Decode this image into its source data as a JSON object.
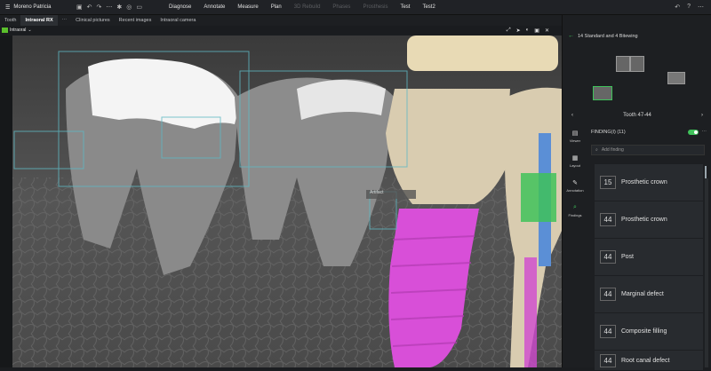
{
  "topbar": {
    "patient_name": "Moreno Patricia",
    "menu": [
      {
        "label": "Diagnose",
        "enabled": true
      },
      {
        "label": "Annotate",
        "enabled": true
      },
      {
        "label": "Measure",
        "enabled": true
      },
      {
        "label": "Plan",
        "enabled": true
      },
      {
        "label": "3D Rebuild",
        "enabled": false
      },
      {
        "label": "Phases",
        "enabled": false
      },
      {
        "label": "Prosthesis",
        "enabled": false
      },
      {
        "label": "Test",
        "enabled": true
      },
      {
        "label": "Test2",
        "enabled": true
      }
    ]
  },
  "tabs": [
    "Tooth",
    "Intraoral RX",
    "Clinical pictures",
    "Recent images",
    "Intraoral camera"
  ],
  "active_tab": "Intraoral RX",
  "image_type": "Intraoral",
  "image_annotation": "Artifact",
  "panel": {
    "series_title": "14 Standard and 4 Bitewing",
    "tooth_nav": "Tooth  47-44",
    "sidebar": [
      {
        "label": "Viewer",
        "icon": "viewer-icon"
      },
      {
        "label": "Layout",
        "icon": "layout-icon"
      },
      {
        "label": "Annotation",
        "icon": "pencil-icon"
      },
      {
        "label": "Findings",
        "icon": "findings-icon"
      }
    ],
    "findings_header": "FINDING(I) (11)",
    "add_finding_placeholder": "Add finding",
    "findings": [
      {
        "tooth": "15",
        "label": "Prosthetic crown",
        "color": "#9aa6ad"
      },
      {
        "tooth": "44",
        "label": "Prosthetic crown",
        "color": "#9aa6ad"
      },
      {
        "tooth": "44",
        "label": "Post",
        "color": "#5b8fd6"
      },
      {
        "tooth": "44",
        "label": "Marginal defect",
        "color": "#e0a13a"
      },
      {
        "tooth": "44",
        "label": "Composite filling",
        "color": "#3fc25a"
      },
      {
        "tooth": "44",
        "label": "Root canal defect",
        "color": "#d04ad0"
      }
    ]
  },
  "colors": {
    "accent": "#3fc25a",
    "implant": "#d84fd8",
    "crown": "#d9ccb0"
  }
}
